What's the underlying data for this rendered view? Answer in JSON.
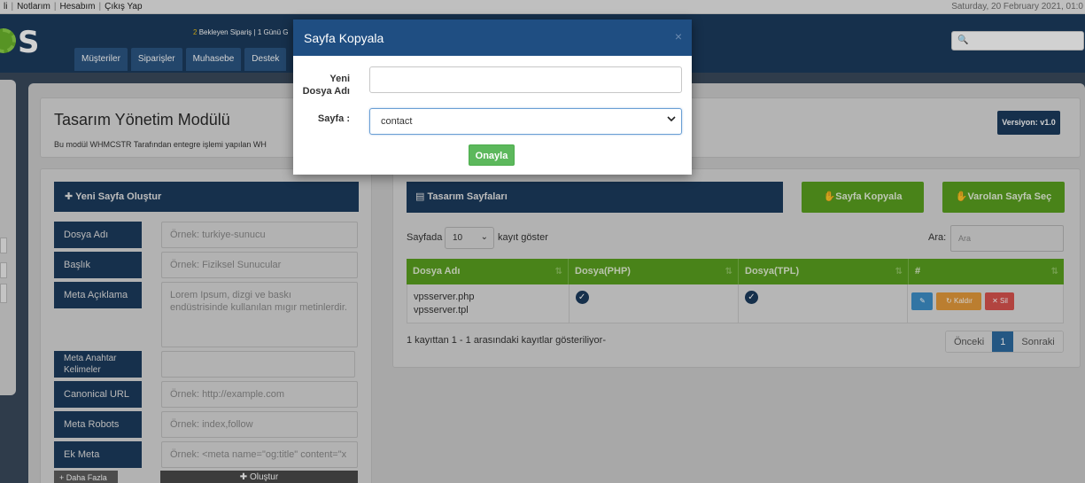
{
  "topbar": {
    "links": [
      "li",
      "Notlarım",
      "Hesabım",
      "Çıkış Yap"
    ],
    "date": "Saturday, 20 February 2021, 01:0"
  },
  "header": {
    "logo_letter": "S",
    "pending_num": "2",
    "pending_text": "Bekleyen Sipariş",
    "pending_sep": "|",
    "pending_rest": "1 Günü G",
    "nav_tabs": [
      "Müşteriler",
      "Siparişler",
      "Muhasebe",
      "Destek"
    ]
  },
  "page": {
    "title": "Tasarım Yönetim Modülü",
    "description": "Bu modül WHMCSTR Tarafından entegre işlemi yapılan WH",
    "version": "Versiyon: v1.0"
  },
  "create_panel": {
    "heading": "Yeni Sayfa Oluştur",
    "fields": [
      {
        "label": "Dosya Adı",
        "placeholder": "Örnek: turkiye-sunucu"
      },
      {
        "label": "Başlık",
        "placeholder": "Örnek: Fiziksel Sunucular"
      },
      {
        "label": "Meta Açıklama",
        "placeholder": "Lorem Ipsum, dizgi ve baskı endüstrisinde kullanılan mıgır metinlerdir."
      },
      {
        "label": "Meta Anahtar Kelimeler",
        "placeholder": ""
      },
      {
        "label": "Canonical URL",
        "placeholder": "Örnek: http://example.com"
      },
      {
        "label": "Meta Robots",
        "placeholder": "Örnek: index,follow"
      },
      {
        "label": "Ek Meta",
        "placeholder": "Örnek: <meta name=\"og:title\" content=\"x"
      }
    ],
    "more_label": "Daha Fazla",
    "create_label": "Oluştur"
  },
  "pages_panel": {
    "heading": "Tasarım Sayfaları",
    "copy_button": "Sayfa Kopyala",
    "select_button": "Varolan Sayfa Seç",
    "length_prefix": "Sayfada",
    "length_value": "10",
    "length_suffix": "kayıt göster",
    "search_label": "Ara:",
    "search_placeholder": "Ara",
    "columns": [
      "Dosya Adı",
      "Dosya(PHP)",
      "Dosya(TPL)",
      "#"
    ],
    "rows": [
      {
        "file_php": "vpsserver.php",
        "file_tpl": "vpsserver.tpl",
        "php_ok": true,
        "tpl_ok": true
      }
    ],
    "actions": {
      "remove": "Kaldır",
      "delete": "Sil"
    },
    "info": "1 kayıttan 1 - 1 arasındaki kayıtlar gösteriliyor-",
    "pager": {
      "prev": "Önceki",
      "current": "1",
      "next": "Sonraki"
    }
  },
  "modal": {
    "title": "Sayfa Kopyala",
    "close": "×",
    "new_name_label_1": "Yeni",
    "new_name_label_2": "Dosya Adı",
    "new_name_value": "",
    "page_label": "Sayfa :",
    "page_value": "contact",
    "confirm": "Onayla"
  },
  "colors": {
    "navy": "#1c3b5d",
    "modal_head": "#1f4e82",
    "green": "#5aa01f",
    "confirm_green": "#5cb85c"
  }
}
